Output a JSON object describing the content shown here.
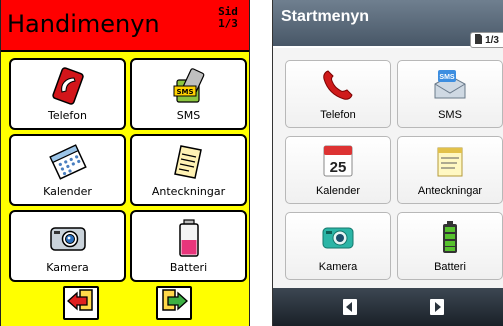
{
  "handimenyn": {
    "title": "Handimenyn",
    "page_label_line1": "Sid",
    "page_label_line2": "1/3",
    "colors": {
      "header": "#ff0000",
      "background": "#ffff00"
    },
    "tiles": [
      {
        "label": "Telefon",
        "icon": "phone-icon"
      },
      {
        "label": "SMS",
        "icon": "sms-icon"
      },
      {
        "label": "Kalender",
        "icon": "calendar-icon"
      },
      {
        "label": "Anteckningar",
        "icon": "notes-icon"
      },
      {
        "label": "Kamera",
        "icon": "camera-icon"
      },
      {
        "label": "Batteri",
        "icon": "battery-icon"
      }
    ],
    "nav": {
      "back_icon": "page-back-icon",
      "forward_icon": "page-forward-icon"
    }
  },
  "startmenyn": {
    "title": "Startmenyn",
    "page_indicator": "1/3",
    "colors": {
      "header": "#56677a",
      "bottom_bar": "#2a333c"
    },
    "tiles": [
      {
        "label": "Telefon",
        "icon": "phone-icon"
      },
      {
        "label": "SMS",
        "icon": "sms-icon"
      },
      {
        "label": "Kalender",
        "icon": "calendar-icon",
        "calendar_day": "25"
      },
      {
        "label": "Anteckningar",
        "icon": "notes-icon"
      },
      {
        "label": "Kamera",
        "icon": "camera-icon"
      },
      {
        "label": "Batteri",
        "icon": "battery-icon"
      }
    ],
    "nav": {
      "back_icon": "page-back-icon",
      "forward_icon": "page-forward-icon"
    }
  }
}
